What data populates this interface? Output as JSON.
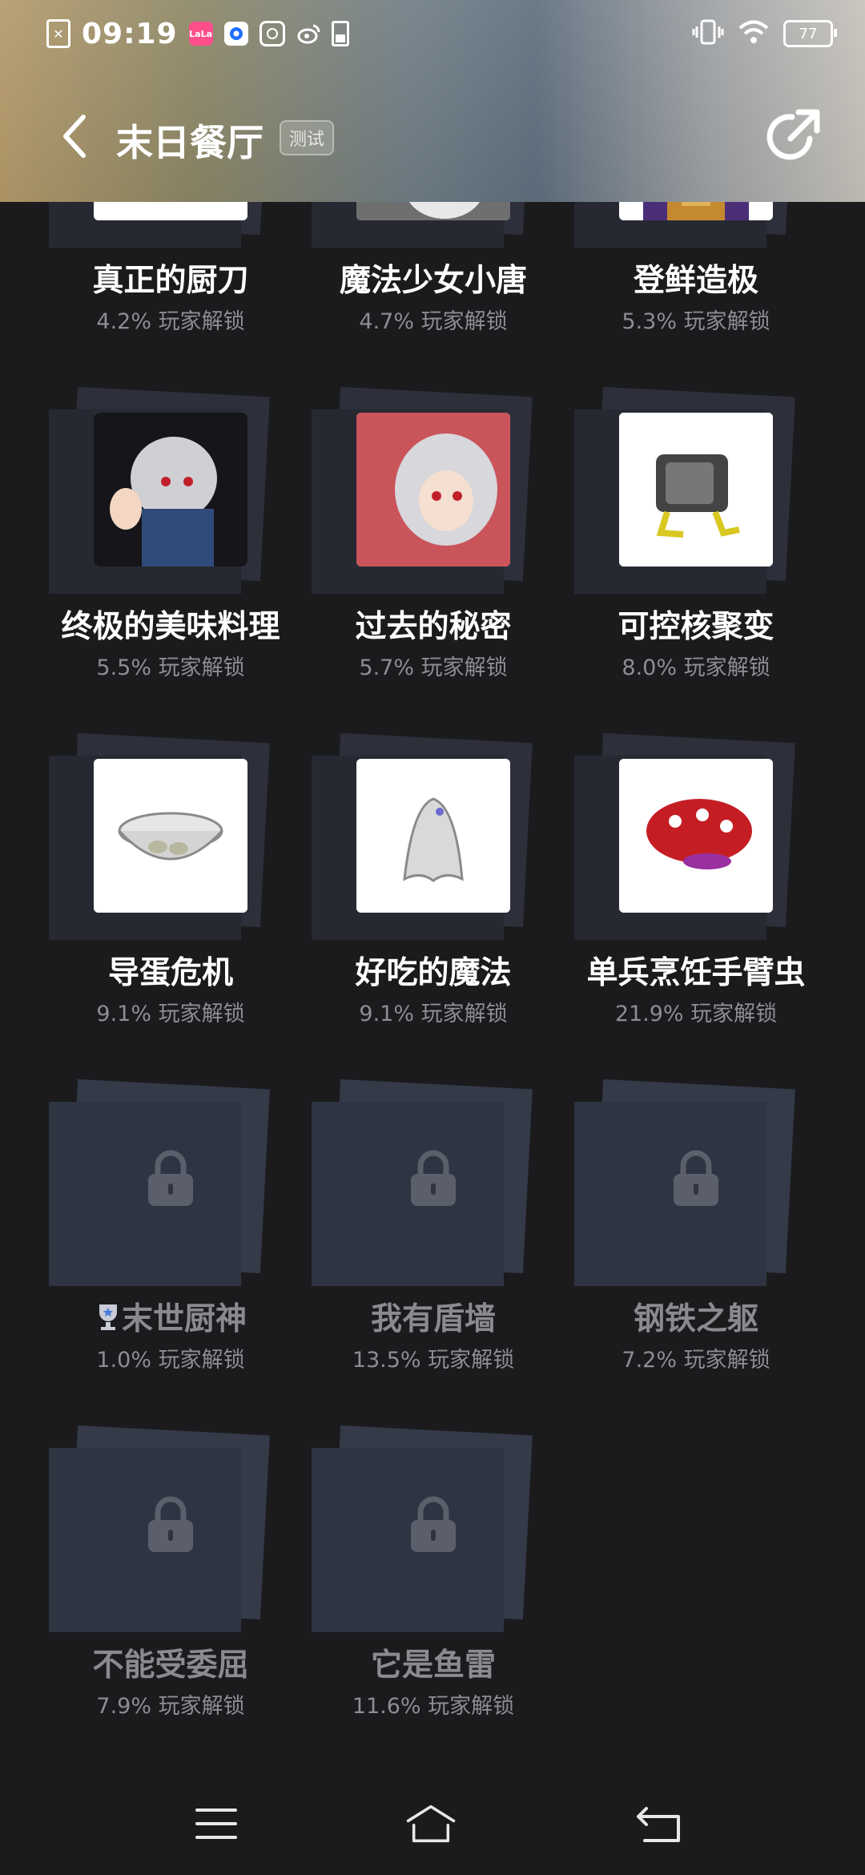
{
  "status_bar": {
    "time": "09:19",
    "notification_icons": [
      "sim-error-icon",
      "lala-app-icon",
      "blue-app-icon",
      "qq-icon",
      "weibo-icon",
      "battery-saver-icon"
    ],
    "battery_level": "77"
  },
  "header": {
    "title": "末日餐厅",
    "badge": "测试",
    "back_icon": "chevron-left-icon",
    "share_icon": "share-icon"
  },
  "achievements": [
    {
      "name": "真正的厨刀",
      "rate": "4.2% 玩家解锁",
      "unlocked": true
    },
    {
      "name": "魔法少女小唐",
      "rate": "4.7% 玩家解锁",
      "unlocked": true
    },
    {
      "name": "登鲜造极",
      "rate": "5.3% 玩家解锁",
      "unlocked": true
    },
    {
      "name": "终极的美味料理",
      "rate": "5.5% 玩家解锁",
      "unlocked": true
    },
    {
      "name": "过去的秘密",
      "rate": "5.7% 玩家解锁",
      "unlocked": true
    },
    {
      "name": "可控核聚变",
      "rate": "8.0% 玩家解锁",
      "unlocked": true
    },
    {
      "name": "导蛋危机",
      "rate": "9.1% 玩家解锁",
      "unlocked": true
    },
    {
      "name": "好吃的魔法",
      "rate": "9.1% 玩家解锁",
      "unlocked": true
    },
    {
      "name": "单兵烹饪手臂虫",
      "rate": "21.9% 玩家解锁",
      "unlocked": true
    },
    {
      "name": "末世厨神",
      "rate": "1.0% 玩家解锁",
      "unlocked": false,
      "trophy": true
    },
    {
      "name": "我有盾墙",
      "rate": "13.5% 玩家解锁",
      "unlocked": false
    },
    {
      "name": "钢铁之躯",
      "rate": "7.2% 玩家解锁",
      "unlocked": false
    },
    {
      "name": "不能受委屈",
      "rate": "7.9% 玩家解锁",
      "unlocked": false
    },
    {
      "name": "它是鱼雷",
      "rate": "11.6% 玩家解锁",
      "unlocked": false
    }
  ],
  "nav": {
    "menu_icon": "menu-icon",
    "home_icon": "home-icon",
    "back_icon": "back-icon"
  },
  "colors": {
    "background": "#1b1b1d",
    "plate": "#2f3340",
    "locked_text": "#8b8b8f",
    "rate_text": "#8d8d92"
  }
}
